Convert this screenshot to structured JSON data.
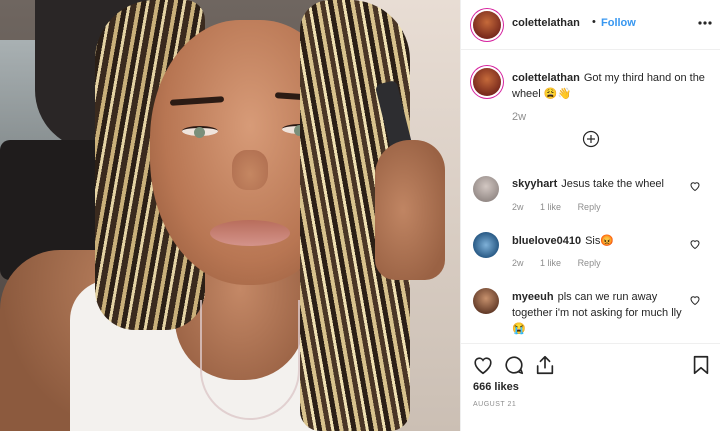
{
  "post": {
    "author": "colettelathan",
    "follow_dot": "•",
    "follow_label": "Follow",
    "caption": "Got my third hand on the wheel 😩👋",
    "caption_time": "2w",
    "likes": "666 likes",
    "date": "AUGUST 21"
  },
  "comments": [
    {
      "username": "skyyhart",
      "text": "Jesus take the wheel",
      "time": "2w",
      "likes": "1 like",
      "reply": "Reply"
    },
    {
      "username": "bluelove0410",
      "text": "Sis😡",
      "time": "2w",
      "likes": "1 like",
      "reply": "Reply"
    },
    {
      "username": "myeeuh",
      "text": "pls can we run away together i'm not asking for much lly 😭"
    }
  ],
  "icons": {
    "more": "more-horizontal-icon",
    "load_more": "plus-circle-icon",
    "like": "heart-icon",
    "comment": "comment-bubble-icon",
    "share": "share-icon",
    "save": "bookmark-icon"
  },
  "colors": {
    "accent": "#3897f0",
    "text": "#262626",
    "muted": "#8e8e8e",
    "border": "#efefef"
  }
}
